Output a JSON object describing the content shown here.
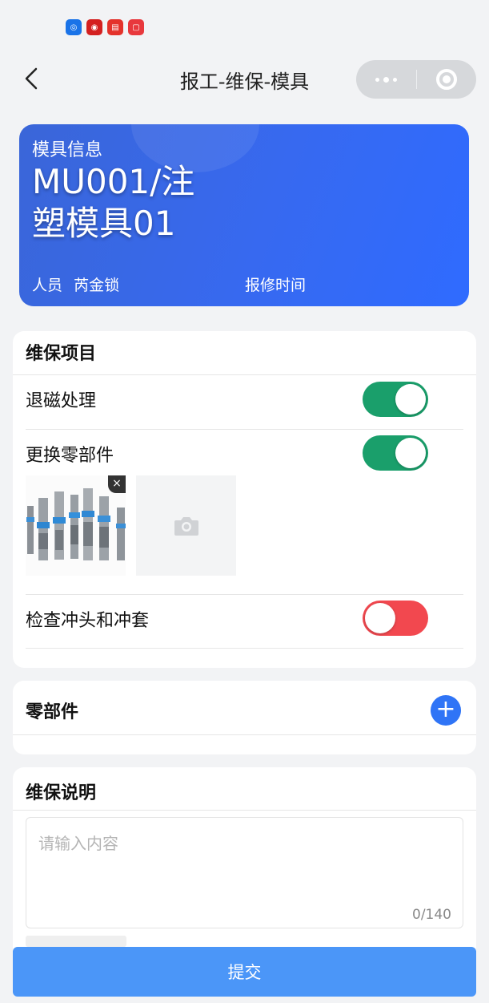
{
  "nav": {
    "title": "报工-维保-模具"
  },
  "mold": {
    "section_label": "模具信息",
    "code_line1": "MU001/注",
    "code_line2": "塑模具01",
    "person_label": "人员",
    "person_name": "芮金锁",
    "repair_time_label": "报修时间"
  },
  "maintenance": {
    "title": "维保项目",
    "items": [
      {
        "label": "退磁处理",
        "enabled": true
      },
      {
        "label": "更换零部件",
        "enabled": true
      },
      {
        "label": "检查冲头和冲套",
        "enabled": false
      }
    ]
  },
  "parts": {
    "title": "零部件"
  },
  "notes": {
    "title": "维保说明",
    "placeholder": "请输入内容",
    "counter": "0/140"
  },
  "submit_label": "提交",
  "colors": {
    "primary": "#3769f0",
    "toggle_on": "#1a9f6b",
    "toggle_off": "#f2484f",
    "submit": "#4b96f8"
  }
}
